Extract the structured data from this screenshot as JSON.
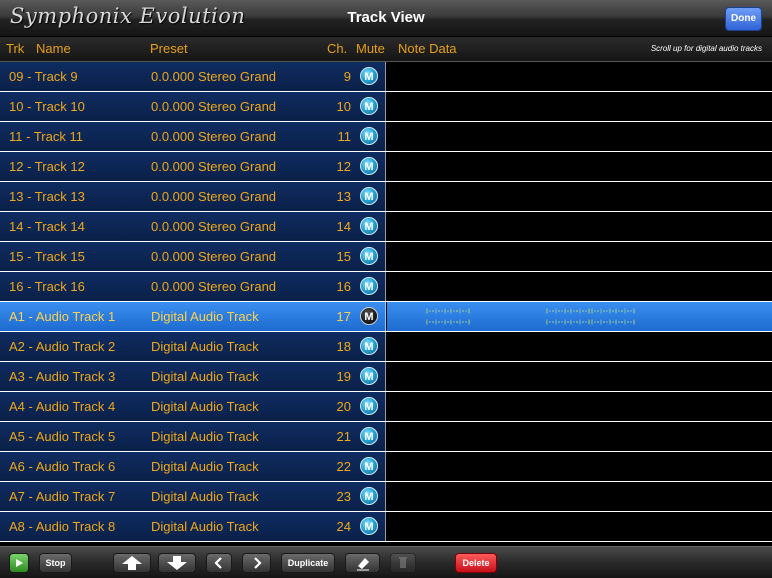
{
  "header": {
    "app_name": "Symphonix Evolution",
    "title": "Track View",
    "done_label": "Done"
  },
  "columns": {
    "trk": "Trk",
    "name": "Name",
    "preset": "Preset",
    "ch": "Ch.",
    "mute": "Mute",
    "note_data": "Note Data",
    "hint": "Scroll up for digital audio tracks"
  },
  "tracks": [
    {
      "name": "09 - Track 9",
      "preset": "0.0.000 Stereo Grand",
      "ch": "9",
      "mute": "M",
      "selected": false
    },
    {
      "name": "10 - Track 10",
      "preset": "0.0.000 Stereo Grand",
      "ch": "10",
      "mute": "M",
      "selected": false
    },
    {
      "name": "11 - Track 11",
      "preset": "0.0.000 Stereo Grand",
      "ch": "11",
      "mute": "M",
      "selected": false
    },
    {
      "name": "12 - Track 12",
      "preset": "0.0.000 Stereo Grand",
      "ch": "12",
      "mute": "M",
      "selected": false
    },
    {
      "name": "13 - Track 13",
      "preset": "0.0.000 Stereo Grand",
      "ch": "13",
      "mute": "M",
      "selected": false
    },
    {
      "name": "14 - Track 14",
      "preset": "0.0.000 Stereo Grand",
      "ch": "14",
      "mute": "M",
      "selected": false
    },
    {
      "name": "15 - Track 15",
      "preset": "0.0.000 Stereo Grand",
      "ch": "15",
      "mute": "M",
      "selected": false
    },
    {
      "name": "16 - Track 16",
      "preset": "0.0.000 Stereo Grand",
      "ch": "16",
      "mute": "M",
      "selected": false
    },
    {
      "name": "A1 - Audio Track 1",
      "preset": "Digital Audio Track",
      "ch": "17",
      "mute": "M",
      "selected": true
    },
    {
      "name": "A2 - Audio Track 2",
      "preset": "Digital Audio Track",
      "ch": "18",
      "mute": "M",
      "selected": false
    },
    {
      "name": "A3 - Audio Track 3",
      "preset": "Digital Audio Track",
      "ch": "19",
      "mute": "M",
      "selected": false
    },
    {
      "name": "A4 - Audio Track 4",
      "preset": "Digital Audio Track",
      "ch": "20",
      "mute": "M",
      "selected": false
    },
    {
      "name": "A5 - Audio Track 5",
      "preset": "Digital Audio Track",
      "ch": "21",
      "mute": "M",
      "selected": false
    },
    {
      "name": "A6 - Audio Track 6",
      "preset": "Digital Audio Track",
      "ch": "22",
      "mute": "M",
      "selected": false
    },
    {
      "name": "A7 - Audio Track 7",
      "preset": "Digital Audio Track",
      "ch": "23",
      "mute": "M",
      "selected": false
    },
    {
      "name": "A8 - Audio Track 8",
      "preset": "Digital Audio Track",
      "ch": "24",
      "mute": "M",
      "selected": false
    }
  ],
  "toolbar": {
    "play_icon": "play-icon",
    "stop_label": "Stop",
    "up_icon": "arrow-up-icon",
    "down_icon": "arrow-down-icon",
    "left_icon": "chevron-left-icon",
    "right_icon": "chevron-right-icon",
    "duplicate_label": "Duplicate",
    "erase_icon": "eraser-icon",
    "trash_icon": "trash-icon",
    "delete_label": "Delete"
  },
  "colors": {
    "text_accent": "#f0a818",
    "row_bg": "#0f2c61",
    "selected_row": "#3b8ff0",
    "mute_button": "#2aa6d6",
    "delete_button": "#c8101a",
    "done_button": "#2f63d6"
  }
}
